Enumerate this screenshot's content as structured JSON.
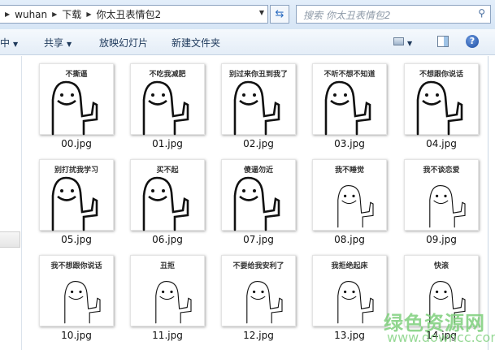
{
  "address": {
    "crumbs": [
      "wuhan",
      "下载",
      "你太丑表情包2"
    ]
  },
  "search": {
    "placeholder": "搜索 你太丑表情包2"
  },
  "toolbar": {
    "organize": "中",
    "share": "共享",
    "slideshow": "放映幻灯片",
    "new_folder": "新建文件夹"
  },
  "files": [
    {
      "name": "00.jpg",
      "caption": "不撕逼"
    },
    {
      "name": "01.jpg",
      "caption": "不吃我减肥"
    },
    {
      "name": "02.jpg",
      "caption": "别过来你丑到我了"
    },
    {
      "name": "03.jpg",
      "caption": "不听不想不知道"
    },
    {
      "name": "04.jpg",
      "caption": "不想跟你说话"
    },
    {
      "name": "05.jpg",
      "caption": "别打扰我学习"
    },
    {
      "name": "06.jpg",
      "caption": "买不起"
    },
    {
      "name": "07.jpg",
      "caption": "傻逼勿近"
    },
    {
      "name": "08.jpg",
      "caption": "我不睡觉"
    },
    {
      "name": "09.jpg",
      "caption": "我不谈恋爱"
    },
    {
      "name": "10.jpg",
      "caption": "我不想跟你说话"
    },
    {
      "name": "11.jpg",
      "caption": "丑拒"
    },
    {
      "name": "12.jpg",
      "caption": "不要给我安利了"
    },
    {
      "name": "13.jpg",
      "caption": "我拒绝起床"
    },
    {
      "name": "14.jpg",
      "caption": "快滚"
    }
  ],
  "watermark": {
    "title": "绿色资源网",
    "url": "www.downcc.com"
  }
}
